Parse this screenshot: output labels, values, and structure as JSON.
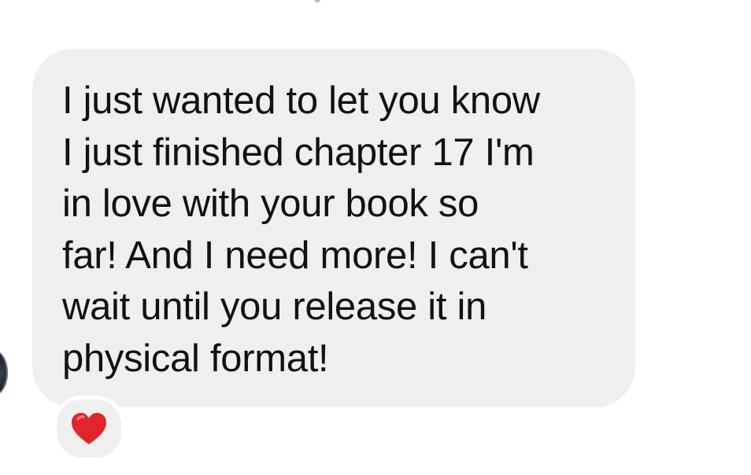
{
  "message": {
    "lines": [
      "I just wanted to let you know",
      "I just finished chapter 17 I'm",
      "in love with your book so",
      "far! And I need more! I can't",
      "wait until you release it in",
      "physical format!"
    ]
  },
  "reaction": {
    "icon": "heart-icon",
    "color": "#e0262a"
  },
  "colors": {
    "bubble": "#efefef",
    "text": "#111111",
    "background": "#ffffff"
  }
}
